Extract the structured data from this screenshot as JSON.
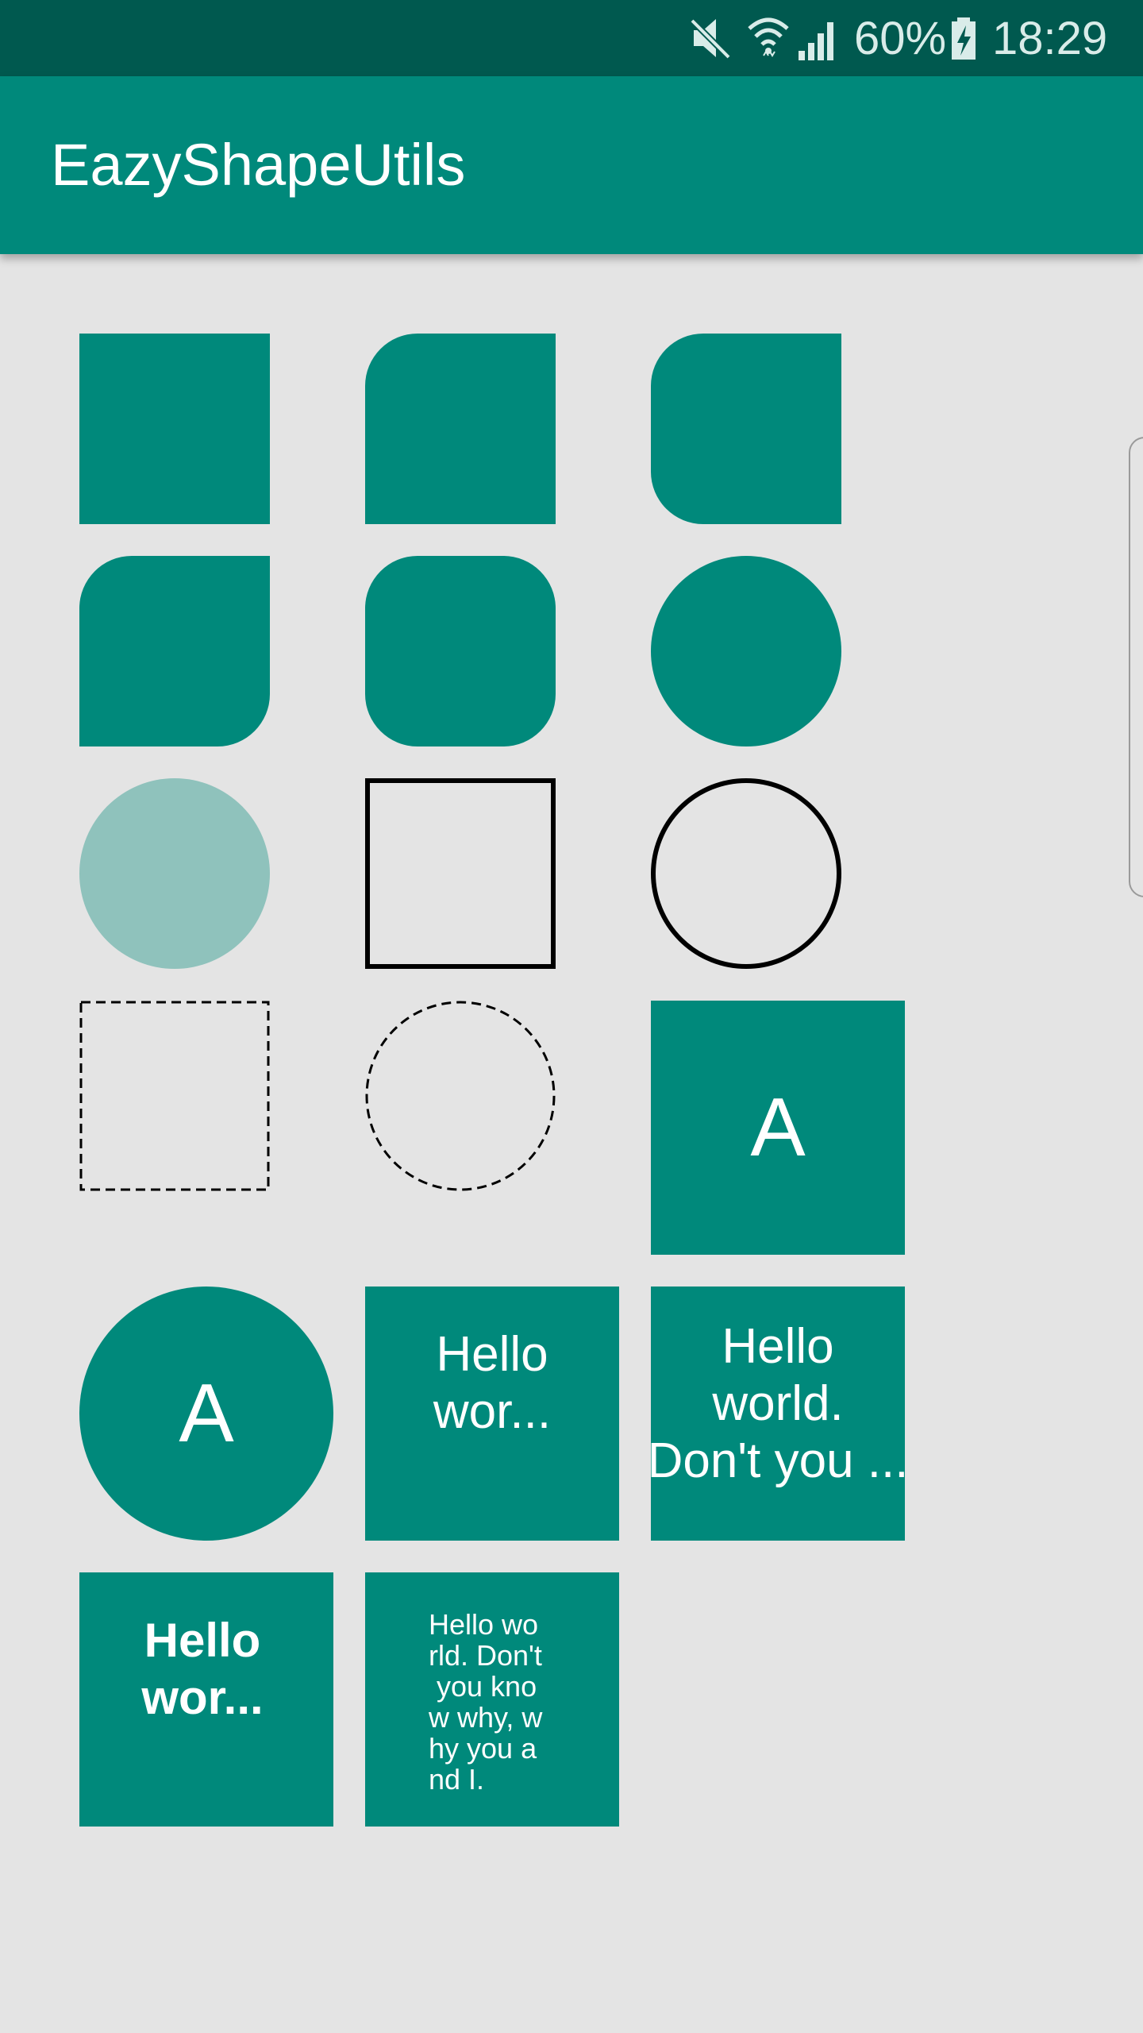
{
  "status_bar": {
    "battery_percent": "60%",
    "time": "18:29",
    "icons": [
      "mute-icon",
      "wifi-icon",
      "signal-icon",
      "battery-charging-icon"
    ]
  },
  "app_bar": {
    "title": "EazyShapeUtils"
  },
  "tiles": {
    "letter_square": "A",
    "letter_circle": "A",
    "hello_two_lines": "Hello\nwor...",
    "hello_three_lines": "Hello\nworld.\nDon't you ...",
    "hello_bold": "Hello\nwor...",
    "hello_small": "Hello wo\nrld. Don't\n you kno\nw why, w\nhy you a\nnd I."
  },
  "colors": {
    "status_bar": "#00594f",
    "app_bar": "#00897b",
    "shape_fill": "#00897b",
    "shape_fill_alpha": "#8fc2bc",
    "background": "#e4e4e4",
    "stroke": "#000000"
  }
}
